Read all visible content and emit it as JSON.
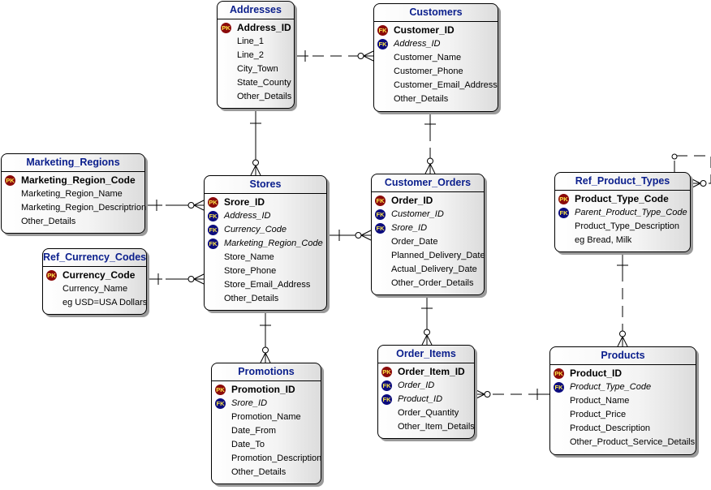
{
  "entities": {
    "addresses": {
      "title": "Addresses",
      "attrs": [
        {
          "name": "Address_ID",
          "key": "PK"
        },
        {
          "name": "Line_1",
          "key": ""
        },
        {
          "name": "Line_2",
          "key": ""
        },
        {
          "name": "City_Town",
          "key": ""
        },
        {
          "name": "State_County",
          "key": ""
        },
        {
          "name": "Other_Details",
          "key": ""
        }
      ]
    },
    "customers": {
      "title": "Customers",
      "attrs": [
        {
          "name": "Customer_ID",
          "key": "FK-PK"
        },
        {
          "name": "Address_ID",
          "key": "FK"
        },
        {
          "name": "Customer_Name",
          "key": ""
        },
        {
          "name": "Customer_Phone",
          "key": ""
        },
        {
          "name": "Customer_Email_Address",
          "key": ""
        },
        {
          "name": "Other_Details",
          "key": ""
        }
      ]
    },
    "marketing_regions": {
      "title": "Marketing_Regions",
      "attrs": [
        {
          "name": "Marketing_Region_Code",
          "key": "PK"
        },
        {
          "name": "Marketing_Region_Name",
          "key": ""
        },
        {
          "name": "Marketing_Region_Descriptrion",
          "key": ""
        },
        {
          "name": "Other_Details",
          "key": ""
        }
      ]
    },
    "ref_currency_codes": {
      "title": "Ref_Currency_Codes",
      "attrs": [
        {
          "name": "Currency_Code",
          "key": "PK"
        },
        {
          "name": "Currency_Name",
          "key": ""
        },
        {
          "name": "eg USD=USA Dollars",
          "key": ""
        }
      ]
    },
    "stores": {
      "title": "Stores",
      "attrs": [
        {
          "name": "Srore_ID",
          "key": "PK"
        },
        {
          "name": "Address_ID",
          "key": "FK"
        },
        {
          "name": "Currency_Code",
          "key": "FK"
        },
        {
          "name": "Marketing_Region_Code",
          "key": "FK"
        },
        {
          "name": "Store_Name",
          "key": ""
        },
        {
          "name": "Store_Phone",
          "key": ""
        },
        {
          "name": "Store_Email_Address",
          "key": ""
        },
        {
          "name": "Other_Details",
          "key": ""
        }
      ]
    },
    "customer_orders": {
      "title": "Customer_Orders",
      "attrs": [
        {
          "name": "Order_ID",
          "key": "FK-PK"
        },
        {
          "name": "Customer_ID",
          "key": "FK"
        },
        {
          "name": "Srore_ID",
          "key": "FK"
        },
        {
          "name": "Order_Date",
          "key": ""
        },
        {
          "name": "Planned_Delivery_Date",
          "key": ""
        },
        {
          "name": "Actual_Delivery_Date",
          "key": ""
        },
        {
          "name": "Other_Order_Details",
          "key": ""
        }
      ]
    },
    "ref_product_types": {
      "title": "Ref_Product_Types",
      "attrs": [
        {
          "name": "Product_Type_Code",
          "key": "PK"
        },
        {
          "name": "Parent_Product_Type_Code",
          "key": "FK"
        },
        {
          "name": "Product_Type_Description",
          "key": ""
        },
        {
          "name": "eg Bread, Milk",
          "key": ""
        }
      ]
    },
    "promotions": {
      "title": "Promotions",
      "attrs": [
        {
          "name": "Promotion_ID",
          "key": "PK"
        },
        {
          "name": "Srore_ID",
          "key": "FK"
        },
        {
          "name": "Promotion_Name",
          "key": ""
        },
        {
          "name": "Date_From",
          "key": ""
        },
        {
          "name": "Date_To",
          "key": ""
        },
        {
          "name": "Promotion_Description",
          "key": ""
        },
        {
          "name": "Other_Details",
          "key": ""
        }
      ]
    },
    "order_items": {
      "title": "Order_Items",
      "attrs": [
        {
          "name": "Order_Item_ID",
          "key": "PK"
        },
        {
          "name": "Order_ID",
          "key": "FK"
        },
        {
          "name": "Product_ID",
          "key": "FK"
        },
        {
          "name": "Order_Quantity",
          "key": ""
        },
        {
          "name": "Other_Item_Details",
          "key": ""
        }
      ]
    },
    "products": {
      "title": "Products",
      "attrs": [
        {
          "name": "Product_ID",
          "key": "PK"
        },
        {
          "name": "Product_Type_Code",
          "key": "FK"
        },
        {
          "name": "Product_Name",
          "key": ""
        },
        {
          "name": "Product_Price",
          "key": ""
        },
        {
          "name": "Product_Description",
          "key": ""
        },
        {
          "name": "Other_Product_Service_Details",
          "key": ""
        }
      ]
    }
  },
  "relationships": [
    {
      "from": "addresses",
      "to": "customers",
      "style": "dashed",
      "one_end": "addresses",
      "many_end": "customers"
    },
    {
      "from": "addresses",
      "to": "stores",
      "style": "solid",
      "one_end": "addresses",
      "many_end": "stores"
    },
    {
      "from": "marketing_regions",
      "to": "stores",
      "style": "solid",
      "one_end": "marketing_regions",
      "many_end": "stores"
    },
    {
      "from": "ref_currency_codes",
      "to": "stores",
      "style": "solid",
      "one_end": "ref_currency_codes",
      "many_end": "stores"
    },
    {
      "from": "stores",
      "to": "customer_orders",
      "style": "solid",
      "one_end": "stores",
      "many_end": "customer_orders"
    },
    {
      "from": "customers",
      "to": "customer_orders",
      "style": "dashed",
      "one_end": "customers",
      "many_end": "customer_orders"
    },
    {
      "from": "stores",
      "to": "promotions",
      "style": "solid",
      "one_end": "stores",
      "many_end": "promotions"
    },
    {
      "from": "customer_orders",
      "to": "order_items",
      "style": "solid",
      "one_end": "customer_orders",
      "many_end": "order_items"
    },
    {
      "from": "products",
      "to": "order_items",
      "style": "dashed",
      "one_end": "products",
      "many_end": "order_items"
    },
    {
      "from": "ref_product_types",
      "to": "products",
      "style": "dashed",
      "one_end": "ref_product_types",
      "many_end": "products"
    },
    {
      "from": "ref_product_types",
      "to": "ref_product_types",
      "style": "dashed",
      "one_end": "ref_product_types",
      "many_end": "ref_product_types"
    }
  ],
  "key_labels": {
    "PK": "PK",
    "FK": "FK"
  }
}
